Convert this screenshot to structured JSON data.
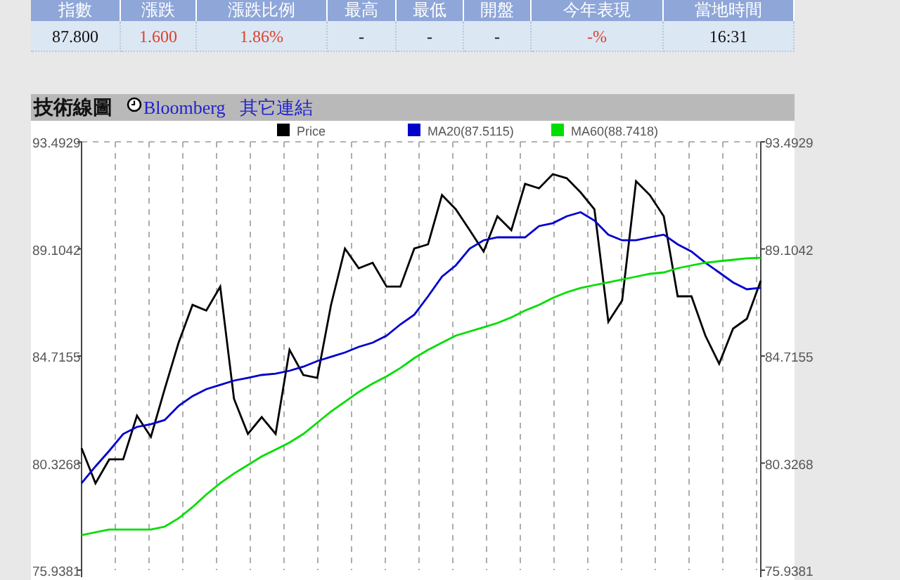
{
  "quote_table": {
    "columns": [
      "指數",
      "漲跌",
      "漲跌比例",
      "最高",
      "最低",
      "開盤",
      "今年表現",
      "當地時間"
    ],
    "row": [
      {
        "text": "87.800"
      },
      {
        "text": "1.600",
        "color": "#d9442c"
      },
      {
        "text": "1.86%",
        "color": "#d9442c"
      },
      {
        "text": "-"
      },
      {
        "text": "-"
      },
      {
        "text": "-"
      },
      {
        "text": "-%",
        "color": "#d9442c"
      },
      {
        "text": "16:31"
      }
    ]
  },
  "chart_panel": {
    "title": "技術線圖",
    "links": [
      "Bloomberg",
      "其它連結"
    ],
    "chart_data": {
      "type": "line",
      "grid": true,
      "legend": true,
      "ylim": [
        75.9381,
        93.4929
      ],
      "yticks": [
        {
          "value": 93.4929,
          "label": "93.4929"
        },
        {
          "value": 89.1042,
          "label": "89.1042"
        },
        {
          "value": 84.7155,
          "label": "84.7155"
        },
        {
          "value": 80.3268,
          "label": "80.3268"
        },
        {
          "value": 75.9381,
          "label": "75.9381"
        }
      ],
      "series": [
        {
          "name": "Price",
          "color": "#000000",
          "values": [
            80.94,
            79.5,
            80.48,
            80.48,
            82.27,
            81.4,
            83.36,
            85.26,
            86.81,
            86.58,
            87.56,
            82.96,
            81.52,
            82.21,
            81.52,
            84.97,
            83.94,
            83.82,
            86.81,
            89.12,
            88.31,
            88.54,
            87.56,
            87.56,
            89.12,
            89.29,
            91.31,
            90.73,
            89.87,
            89.0,
            90.44,
            89.87,
            91.77,
            91.59,
            92.17,
            92.0,
            91.42,
            90.73,
            86.12,
            86.99,
            91.88,
            91.31,
            90.44,
            87.16,
            87.16,
            85.55,
            84.4,
            85.84,
            86.24,
            87.8
          ]
        },
        {
          "name": "MA20(87.5115)",
          "color": "#0000cc",
          "values": [
            79.5,
            80.19,
            80.83,
            81.52,
            81.81,
            81.92,
            82.09,
            82.67,
            83.07,
            83.36,
            83.53,
            83.71,
            83.82,
            83.94,
            83.99,
            84.11,
            84.28,
            84.51,
            84.68,
            84.86,
            85.09,
            85.26,
            85.55,
            86.01,
            86.41,
            87.16,
            87.97,
            88.43,
            89.12,
            89.46,
            89.58,
            89.58,
            89.58,
            90.04,
            90.16,
            90.44,
            90.61,
            90.27,
            89.69,
            89.46,
            89.46,
            89.58,
            89.69,
            89.29,
            89.0,
            88.54,
            88.14,
            87.73,
            87.45,
            87.51
          ]
        },
        {
          "name": "MA60(88.7418)",
          "color": "#00dd00",
          "values": [
            77.37,
            77.49,
            77.6,
            77.6,
            77.6,
            77.6,
            77.72,
            78.06,
            78.52,
            79.04,
            79.5,
            79.9,
            80.25,
            80.6,
            80.88,
            81.17,
            81.52,
            81.98,
            82.44,
            82.84,
            83.24,
            83.59,
            83.88,
            84.22,
            84.63,
            84.97,
            85.26,
            85.55,
            85.72,
            85.89,
            86.07,
            86.3,
            86.58,
            86.81,
            87.1,
            87.33,
            87.5,
            87.62,
            87.73,
            87.85,
            87.97,
            88.08,
            88.14,
            88.31,
            88.43,
            88.54,
            88.6,
            88.66,
            88.72,
            88.74
          ]
        }
      ]
    }
  }
}
